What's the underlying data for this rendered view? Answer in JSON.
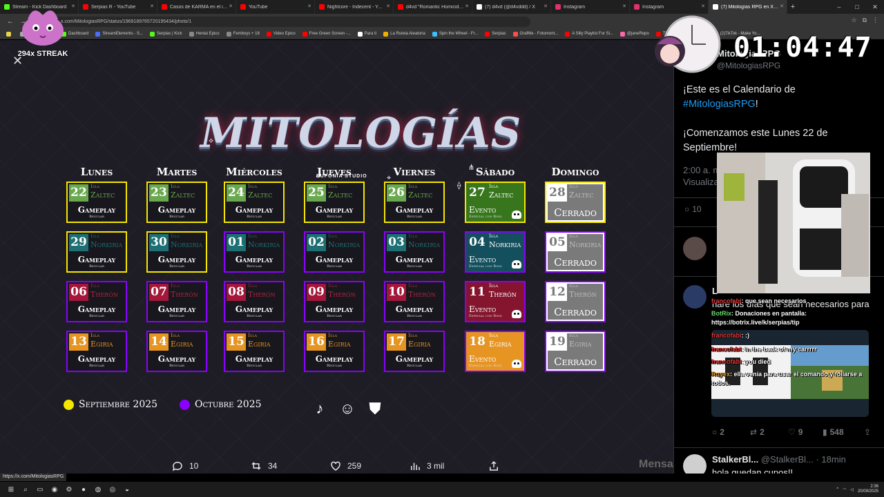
{
  "browser": {
    "tabs": [
      {
        "title": "Stream - Kick Dashboard",
        "color": "#53fc18"
      },
      {
        "title": "Serpias R - YouTube",
        "color": "#ff0000"
      },
      {
        "title": "Casos de KARMA en el interne",
        "color": "#ff0000"
      },
      {
        "title": "YouTube",
        "color": "#ff0000"
      },
      {
        "title": "Nightcore - Indecent - YouTu",
        "color": "#ff0000"
      },
      {
        "title": "d4vd \"Romantic Homicide\" Of",
        "color": "#ff0000"
      },
      {
        "title": "(7) d4vd (@d4vddd) / X",
        "color": "#ffffff"
      },
      {
        "title": "Instagram",
        "color": "#e1306c"
      },
      {
        "title": "Instagram",
        "color": "#e1306c"
      },
      {
        "title": "(7) Mitologías RPG en X: \"¡Est",
        "color": "#ffffff",
        "active": true
      }
    ],
    "new_tab": "+",
    "url": "x.com/MitologiasRPG/status/1969189765720195434/photo/1",
    "bookmarks": [
      {
        "label": "",
        "color": "#e8d54b"
      },
      {
        "label": "",
        "color": "#aaaaaa"
      },
      {
        "label": "",
        "color": "#ffffff"
      },
      {
        "label": "",
        "color": "#25f4ee"
      },
      {
        "label": "Dashboard",
        "color": "#53fc18"
      },
      {
        "label": "StreamElements - S...",
        "color": "#4b6cff"
      },
      {
        "label": "Serpias | Kick",
        "color": "#53fc18"
      },
      {
        "label": "Hentai Epico",
        "color": "#888888"
      },
      {
        "label": "Femboys + 18",
        "color": "#888888"
      },
      {
        "label": "Video Epico",
        "color": "#ff0000"
      },
      {
        "label": "Free Green Screen -...",
        "color": "#ff0000"
      },
      {
        "label": "Para ti",
        "color": "#ffffff"
      },
      {
        "label": "La Ruleta Aleatoria",
        "color": "#f0b000"
      },
      {
        "label": "Spin the Wheel - Fr...",
        "color": "#38c1ff"
      },
      {
        "label": "Serpias",
        "color": "#ff0000"
      },
      {
        "label": "GrafMe - Fotomont...",
        "color": "#ff4d4d"
      },
      {
        "label": "A Silly Playlist For Si...",
        "color": "#ff0000"
      },
      {
        "label": "@janeRepo",
        "color": "#ff66aa"
      },
      {
        "label": "The BEST CS2 Settin...",
        "color": "#ff0000"
      },
      {
        "label": "(2)TikTok - Make Yo...",
        "color": "#ffffff"
      }
    ],
    "status_url": "https://x.com/MitologiasRPG"
  },
  "overlay": {
    "streak": "294x STREAK",
    "timer": "01:04:47"
  },
  "calendar": {
    "days": [
      "Lunes",
      "Martes",
      "Miércoles",
      "Jueves",
      "Viernes",
      "Sábado",
      "Domingo"
    ],
    "weeks": [
      {
        "island_word": "Isla",
        "island": "Zaltec",
        "num_color": "#6aa84f",
        "text_color": "#6aa84f",
        "event_bg": "#38761d",
        "cells": [
          {
            "num": "22",
            "month": "sep",
            "type": "gameplay"
          },
          {
            "num": "23",
            "month": "sep",
            "type": "gameplay"
          },
          {
            "num": "24",
            "month": "sep",
            "type": "gameplay"
          },
          {
            "num": "25",
            "month": "sep",
            "type": "gameplay"
          },
          {
            "num": "26",
            "month": "sep",
            "type": "gameplay"
          },
          {
            "num": "27",
            "month": "sep",
            "type": "event"
          },
          {
            "num": "28",
            "month": "sep",
            "type": "closed"
          }
        ]
      },
      {
        "island_word": "Isla",
        "island": "Norkiria",
        "num_color": "#1d6f73",
        "text_color": "#1d6f73",
        "event_bg": "#134f5c",
        "cells": [
          {
            "num": "29",
            "month": "sep",
            "type": "gameplay"
          },
          {
            "num": "30",
            "month": "sep",
            "type": "gameplay"
          },
          {
            "num": "01",
            "month": "oct",
            "type": "gameplay"
          },
          {
            "num": "02",
            "month": "oct",
            "type": "gameplay"
          },
          {
            "num": "03",
            "month": "oct",
            "type": "gameplay"
          },
          {
            "num": "04",
            "month": "oct",
            "type": "event"
          },
          {
            "num": "05",
            "month": "oct",
            "type": "closed"
          }
        ]
      },
      {
        "island_word": "Isla",
        "island": "Therón",
        "num_color": "#a3173a",
        "text_color": "#b0263e",
        "event_bg": "#85152f",
        "cells": [
          {
            "num": "06",
            "month": "oct",
            "type": "gameplay"
          },
          {
            "num": "07",
            "month": "oct",
            "type": "gameplay"
          },
          {
            "num": "08",
            "month": "oct",
            "type": "gameplay"
          },
          {
            "num": "09",
            "month": "oct",
            "type": "gameplay"
          },
          {
            "num": "10",
            "month": "oct",
            "type": "gameplay"
          },
          {
            "num": "11",
            "month": "oct",
            "type": "event"
          },
          {
            "num": "12",
            "month": "oct",
            "type": "closed"
          }
        ]
      },
      {
        "island_word": "Isla",
        "island": "Egiria",
        "num_color": "#e69422",
        "text_color": "#e69422",
        "event_bg": "#e69422",
        "cells": [
          {
            "num": "13",
            "month": "oct",
            "type": "gameplay"
          },
          {
            "num": "14",
            "month": "oct",
            "type": "gameplay"
          },
          {
            "num": "15",
            "month": "oct",
            "type": "gameplay"
          },
          {
            "num": "16",
            "month": "oct",
            "type": "gameplay"
          },
          {
            "num": "17",
            "month": "oct",
            "type": "gameplay"
          },
          {
            "num": "18",
            "month": "oct",
            "type": "event"
          },
          {
            "num": "19",
            "month": "oct",
            "type": "closed"
          }
        ]
      }
    ],
    "gameplay_label": "Gameplay",
    "gameplay_sub": "Regular",
    "event_label": "Evento",
    "event_sub": "Especial con Boss",
    "closed_label": "Cerrado",
    "legend": [
      {
        "label": "Septiembre 2025",
        "color": "#f5e700"
      },
      {
        "label": "Octubre 2025",
        "color": "#8a00ff"
      }
    ],
    "logo_text": "MITOLOGÍAS",
    "studio_text": "EUFONIA STUDIO"
  },
  "post_stats": {
    "replies": "10",
    "reposts": "34",
    "likes": "259",
    "views": "3 mil"
  },
  "panel": {
    "author": "MitologiasRPG",
    "author_handle": "@MitologiasRPG",
    "tweet_line1": "¡Este es el Calendario de",
    "tweet_hashtag": "#MitologiasRPG",
    "tweet_excl": "!",
    "tweet_line3": "¡Comenzamos este Lunes 22 de Septiembre!",
    "time": "2:00 a. m.",
    "views_label": "Visualizaciones",
    "reply_count": "10",
    "reply2_name": "L",
    "reply2_text": "haré los días que sean necesarios para",
    "reply2_stats": {
      "replies": "2",
      "reposts": "2",
      "likes": "9",
      "views": "548"
    },
    "reply3_name": "StalkerBl...",
    "reply3_handle": "@StalkerBl... · 18min",
    "reply3_text": "hola quedan cupos!!",
    "message_hint": "Mensa"
  },
  "chat": [
    {
      "user": "francofabi",
      "user_color": "r",
      "text": ": que sean necesarios"
    },
    {
      "user": "BotRix",
      "user_color": "g",
      "text": ": Donaciones en pantalla: https://botrix.live/k/serpias/tip"
    },
    {
      "user": "francofabi",
      "user_color": "r",
      "text": ": :)"
    },
    {
      "user": "francofabi",
      "user_color": "r",
      "text": ": in the back of my carrrrr"
    },
    {
      "user": "francofabi",
      "user_color": "r",
      "text": ": you died"
    },
    {
      "user": "Ruyex",
      "user_color": "o",
      "text": ": ella venía para usar el comando y follarse a todos."
    }
  ],
  "taskbar": {
    "time": "2:36",
    "date": "20/09/2025"
  }
}
